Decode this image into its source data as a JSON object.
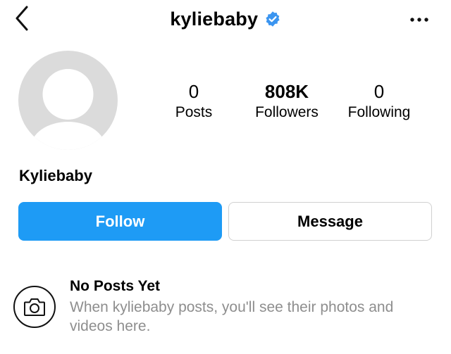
{
  "header": {
    "title": "kyliebaby",
    "verified": true,
    "back_icon": "chevron-left-icon",
    "more_icon": "more-horizontal-icon"
  },
  "stats": {
    "posts_value": "0",
    "posts_label": "Posts",
    "followers_value": "808K",
    "followers_label": "Followers",
    "following_value": "0",
    "following_label": "Following"
  },
  "profile": {
    "name": "Kyliebaby"
  },
  "actions": {
    "follow_label": "Follow",
    "message_label": "Message"
  },
  "empty_state": {
    "icon": "camera-icon",
    "title": "No Posts Yet",
    "description": "When kyliebaby posts, you'll see their photos and videos here."
  },
  "colors": {
    "accent": "#1e9bf5",
    "verified": "#3b95f0",
    "avatar_bg": "#dbdbdb",
    "secondary_text": "#8e8e8e",
    "border": "#d0d0d0"
  }
}
